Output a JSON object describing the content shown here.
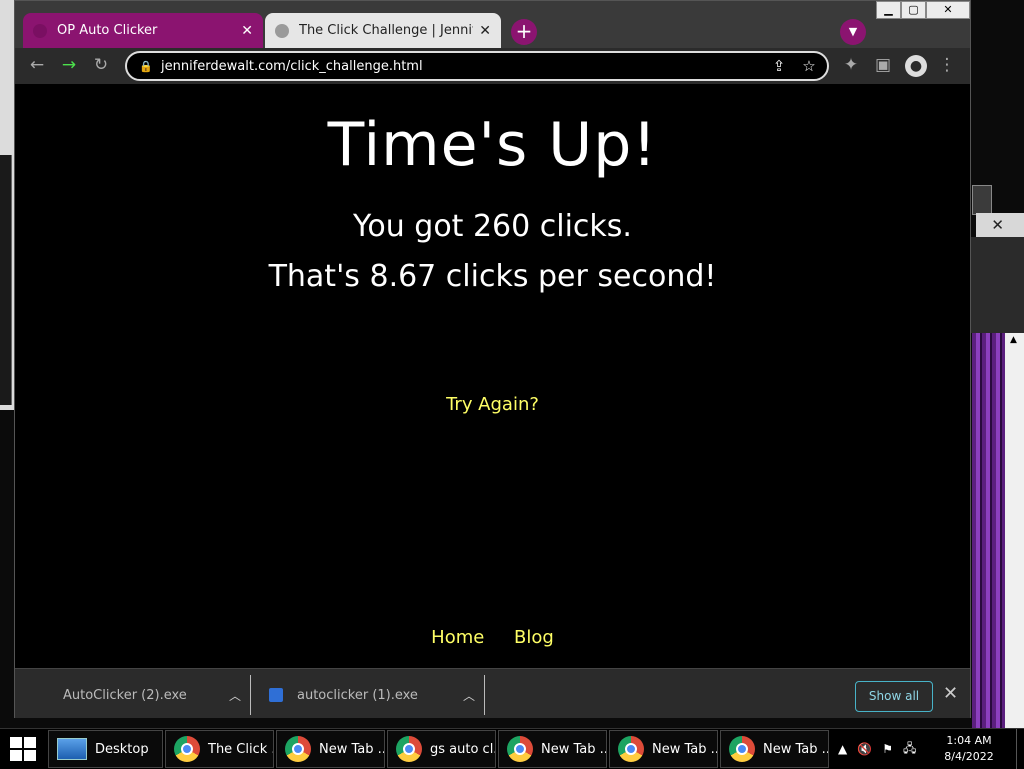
{
  "browser": {
    "tabs": [
      {
        "title": "OP Auto Clicker",
        "close": "✕"
      },
      {
        "title": "The Click Challenge | Jennifer De",
        "close": "✕"
      }
    ],
    "new_tab": "+",
    "url": "jenniferdewalt.com/click_challenge.html",
    "window_controls": {
      "min": "▁",
      "max": "▢",
      "close": "✕"
    }
  },
  "page": {
    "heading": "Time's Up!",
    "result_line1": "You got 260 clicks.",
    "result_line2": "That's 8.67 clicks per second!",
    "try_again": "Try Again?",
    "footer": {
      "home": "Home",
      "blog": "Blog"
    }
  },
  "downloads": {
    "items": [
      {
        "name": "AutoClicker (2).exe"
      },
      {
        "name": "autoclicker (1).exe"
      }
    ],
    "show_all": "Show all"
  },
  "taskbar": {
    "tasks": [
      {
        "label": "Desktop"
      },
      {
        "label": "The Click ..."
      },
      {
        "label": "New Tab ..."
      },
      {
        "label": "gs auto cl..."
      },
      {
        "label": "New Tab ..."
      },
      {
        "label": "New Tab ..."
      },
      {
        "label": "New Tab ..."
      }
    ],
    "clock_time": "1:04 AM",
    "clock_date": "8/4/2022"
  },
  "colors": {
    "tab_accent": "#8b1470",
    "link_yellow": "#ffff66",
    "show_all_border": "#48b3c8"
  }
}
